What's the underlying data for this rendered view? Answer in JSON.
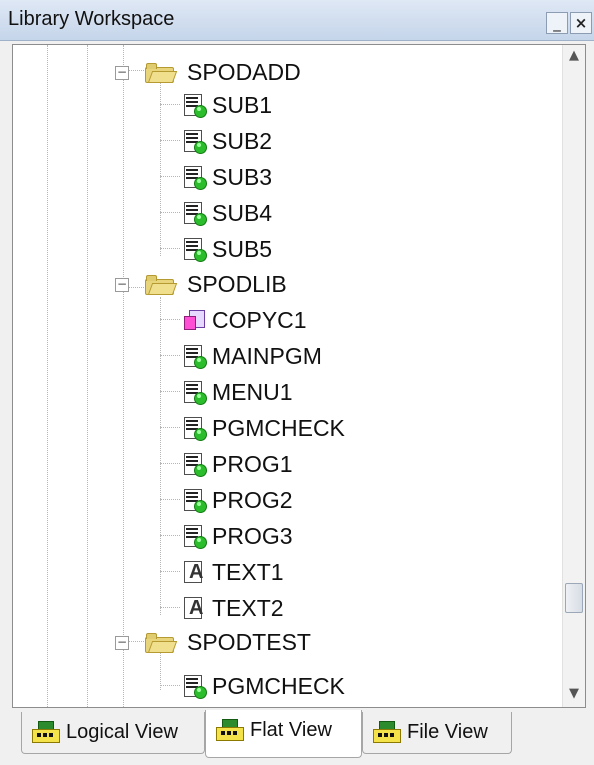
{
  "window": {
    "title": "Library Workspace",
    "minimize_symbol": "_",
    "close_symbol": "×"
  },
  "tree": {
    "groups": [
      {
        "name": "SPODADD",
        "items": [
          {
            "label": "SUB1",
            "icon": "program-icon"
          },
          {
            "label": "SUB2",
            "icon": "program-icon"
          },
          {
            "label": "SUB3",
            "icon": "program-icon"
          },
          {
            "label": "SUB4",
            "icon": "program-icon"
          },
          {
            "label": "SUB5",
            "icon": "program-icon"
          }
        ]
      },
      {
        "name": "SPODLIB",
        "items": [
          {
            "label": "COPYC1",
            "icon": "copybook-icon"
          },
          {
            "label": "MAINPGM",
            "icon": "program-icon"
          },
          {
            "label": "MENU1",
            "icon": "program-icon"
          },
          {
            "label": "PGMCHECK",
            "icon": "program-icon"
          },
          {
            "label": "PROG1",
            "icon": "program-icon"
          },
          {
            "label": "PROG2",
            "icon": "program-icon"
          },
          {
            "label": "PROG3",
            "icon": "program-icon"
          },
          {
            "label": "TEXT1",
            "icon": "text-file-icon"
          },
          {
            "label": "TEXT2",
            "icon": "text-file-icon"
          }
        ]
      },
      {
        "name": "SPODTEST",
        "items": [
          {
            "label": "PGMCHECK",
            "icon": "program-icon"
          }
        ]
      }
    ]
  },
  "tabs": [
    {
      "label": "Logical View",
      "active": false
    },
    {
      "label": "Flat View",
      "active": true
    },
    {
      "label": "File View",
      "active": false
    }
  ],
  "scrollbar": {
    "up_arrow": "▲",
    "down_arrow": "▼"
  }
}
